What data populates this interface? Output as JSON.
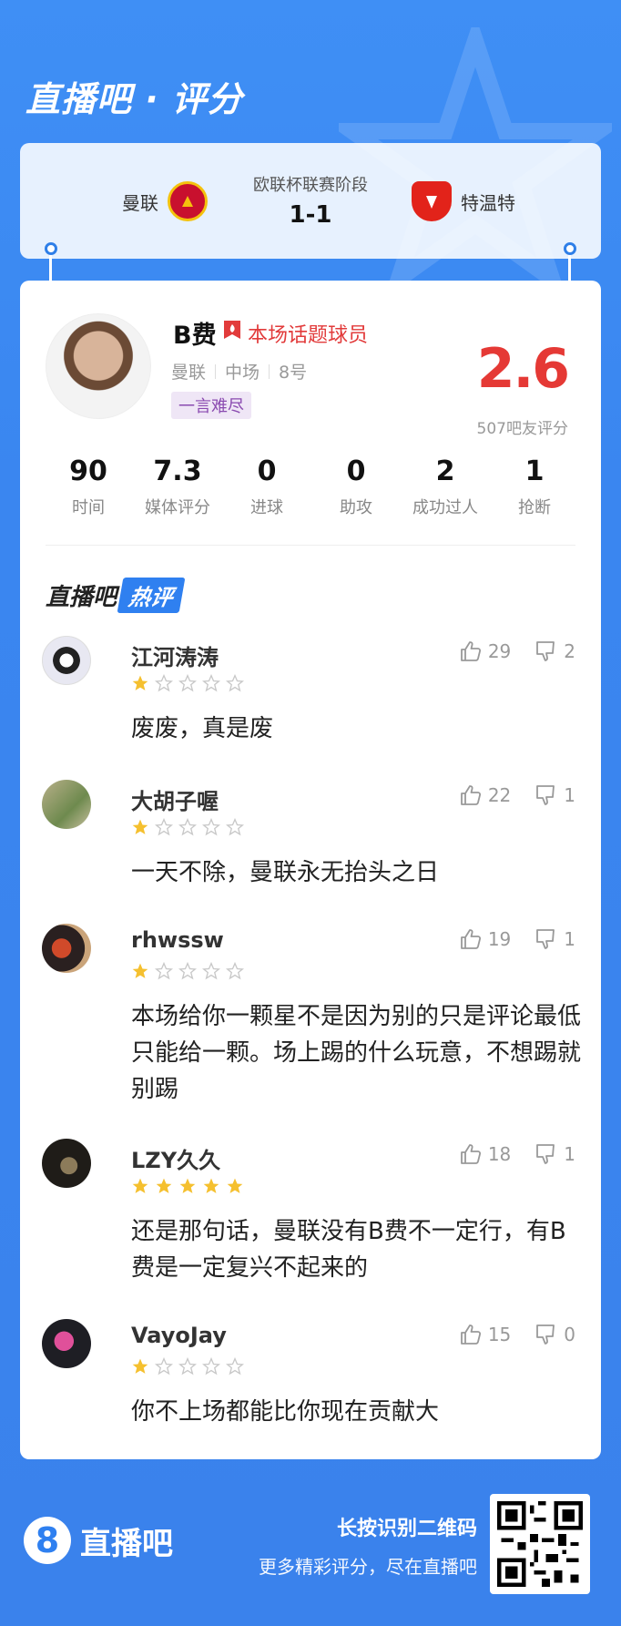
{
  "brand": {
    "title": "直播吧 · 评分"
  },
  "match": {
    "stage": "欧联杯联赛阶段",
    "score": "1-1",
    "home_team": "曼联",
    "away_team": "特温特"
  },
  "player": {
    "name": "B费",
    "hot_label": "本场话题球员",
    "team": "曼联",
    "position": "中场",
    "number": "8号",
    "tag": "一言难尽",
    "rating": "2.6",
    "rating_count": "507吧友评分"
  },
  "stats": [
    {
      "value": "90",
      "label": "时间"
    },
    {
      "value": "7.3",
      "label": "媒体评分"
    },
    {
      "value": "0",
      "label": "进球"
    },
    {
      "value": "0",
      "label": "助攻"
    },
    {
      "value": "2",
      "label": "成功过人"
    },
    {
      "value": "1",
      "label": "抢断"
    }
  ],
  "hot_section": {
    "title_left": "直播吧",
    "title_right": "热评"
  },
  "comments": [
    {
      "user": "江河涛涛",
      "stars": 1,
      "likes": "29",
      "dislikes": "2",
      "text": "废废，真是废"
    },
    {
      "user": "大胡子喔",
      "stars": 1,
      "likes": "22",
      "dislikes": "1",
      "text": "一天不除，曼联永无抬头之日"
    },
    {
      "user": "rhwssw",
      "stars": 1,
      "likes": "19",
      "dislikes": "1",
      "text": "本场给你一颗星不是因为别的只是评论最低只能给一颗。场上踢的什么玩意，不想踢就别踢"
    },
    {
      "user": "LZY久久",
      "stars": 5,
      "likes": "18",
      "dislikes": "1",
      "text": "还是那句话，曼联没有B费不一定行，有B费是一定复兴不起来的"
    },
    {
      "user": "VayoJay",
      "stars": 1,
      "likes": "15",
      "dislikes": "0",
      "text": "你不上场都能比你现在贡献大"
    }
  ],
  "footer": {
    "logo_glyph": "8",
    "logo_text": "直播吧",
    "cta_line1": "长按识别二维码",
    "cta_line2": "更多精彩评分，尽在直播吧"
  },
  "colors": {
    "accent": "#2f80f0",
    "rating": "#e53935",
    "star": "#f5c02f"
  }
}
